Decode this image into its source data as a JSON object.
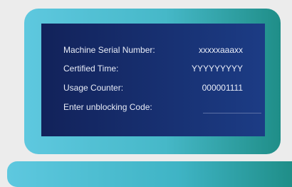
{
  "screen": {
    "fields": [
      {
        "label": "Machine Serial Number:",
        "value": "xxxxxaaaxx"
      },
      {
        "label": "Certified Time:",
        "value": "YYYYYYYYY"
      },
      {
        "label": "Usage Counter:",
        "value": "000001111"
      },
      {
        "label": "Enter unblocking Code:",
        "value": ""
      }
    ]
  },
  "colors": {
    "frame_accent": "#46b8c8",
    "screen_bg": "#1c3c85",
    "text": "#e8ecf7"
  }
}
